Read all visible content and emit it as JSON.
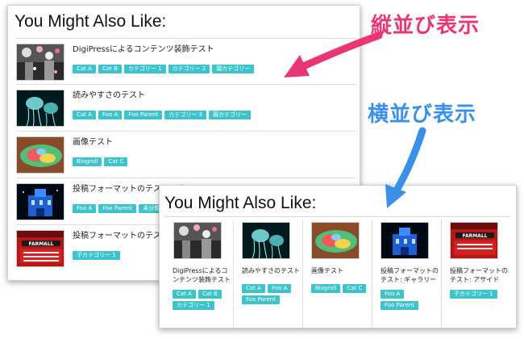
{
  "annotations": {
    "vertical_label": "縦並び表示",
    "horizontal_label": "横並び表示",
    "vertical_color": "#e93573",
    "horizontal_color": "#3a8fe8"
  },
  "vertical_widget": {
    "title": "You Might Also Like:",
    "items": [
      {
        "title": "DigiPressによるコンテンツ装飾テスト",
        "tags": [
          "Cat A",
          "Cat B",
          "カテゴリー 1",
          "カテゴリー 2",
          "親カテゴリー"
        ]
      },
      {
        "title": "読みやすさのテスト",
        "tags": [
          "Cat A",
          "Foo A",
          "Foo Parent",
          "カテゴリー 3",
          "親カテゴリー"
        ]
      },
      {
        "title": "画像テスト",
        "tags": [
          "Blogroll",
          "Cat C"
        ]
      },
      {
        "title": "投稿フォーマットのテスト: ギャラリー",
        "tags": [
          "Foo A",
          "Foo Parent",
          "未分類"
        ]
      },
      {
        "title": "投稿フォーマットのテスト: アサイド",
        "tags": [
          "子カテゴリー 1"
        ]
      }
    ]
  },
  "horizontal_widget": {
    "title": "You Might Also Like:",
    "items": [
      {
        "title": "DigiPressによるコンテンツ装飾テスト",
        "tags": [
          "Cat A",
          "Cat B",
          "カテゴリー 1"
        ]
      },
      {
        "title": "読みやすさのテスト",
        "tags": [
          "Cat A",
          "Foo A",
          "Foo Parent"
        ]
      },
      {
        "title": "画像テスト",
        "tags": [
          "Blogroll",
          "Cat C"
        ]
      },
      {
        "title": "投稿フォーマットのテスト: ギャラリー",
        "tags": [
          "Foo A",
          "Foo Parent"
        ]
      },
      {
        "title": "投稿フォーマットのテスト: アサイド",
        "tags": [
          "子カテゴリー 1"
        ]
      }
    ]
  },
  "colors": {
    "tag_background": "#3cc3cb",
    "tag_text": "#ffffff"
  }
}
